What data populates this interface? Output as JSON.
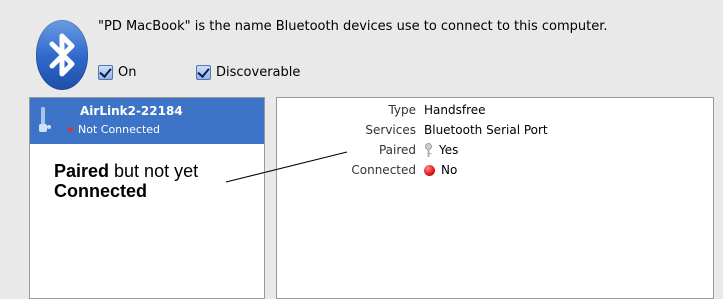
{
  "header": {
    "name_message": "\"PD MacBook\" is the name Bluetooth devices use to connect to this computer."
  },
  "options": {
    "on_label": "On",
    "on_checked": true,
    "discoverable_label": "Discoverable",
    "discoverable_checked": true
  },
  "devices": [
    {
      "name": "AirLink2-22184",
      "status": "Not Connected",
      "selected": true
    }
  ],
  "details": {
    "type_label": "Type",
    "type_value": "Handsfree",
    "services_label": "Services",
    "services_value": "Bluetooth Serial Port",
    "paired_label": "Paired",
    "paired_value": "Yes",
    "connected_label": "Connected",
    "connected_value": "No"
  },
  "annotation": {
    "part1_bold": "Paired",
    "part2": " but not yet",
    "part3_bold": "Connected"
  },
  "colors": {
    "selection": "#3d74c7",
    "status_red": "#e3323a"
  },
  "icons": {
    "bluetooth": "bluetooth-icon",
    "device": "headset-icon",
    "paired": "key-icon",
    "connected": "red-dot-icon"
  }
}
